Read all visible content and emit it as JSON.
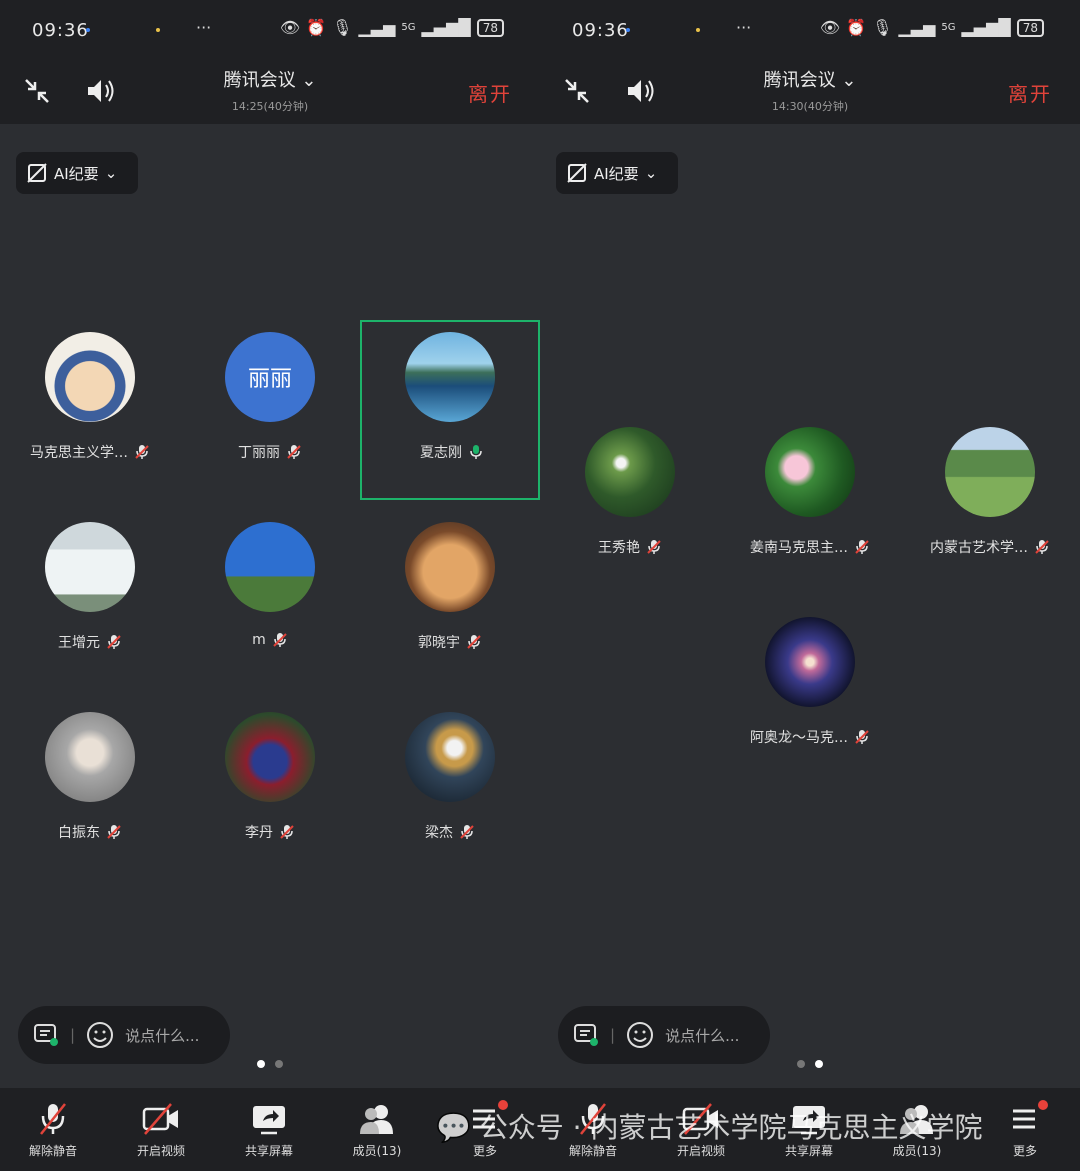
{
  "status": {
    "time": "09:36",
    "dots": "···",
    "network": "5G",
    "battery": "78"
  },
  "header": {
    "title": "腾讯会议",
    "leave": "离开"
  },
  "ai_button": {
    "label": "AI纪要"
  },
  "chat": {
    "placeholder": "说点什么..."
  },
  "toolbar": {
    "mic": "解除静音",
    "video": "开启视频",
    "share": "共享屏幕",
    "members": "成员(13)",
    "more": "更多"
  },
  "watermark": "公众号 · 内蒙古艺术学院马克思主义学院",
  "screens": [
    {
      "duration": "14:25(40分钟)",
      "participants": [
        {
          "name": "马克思主义学…",
          "avatar_text": "",
          "speaking": false
        },
        {
          "name": "丁丽丽",
          "avatar_text": "丽丽",
          "speaking": false
        },
        {
          "name": "夏志刚",
          "avatar_text": "",
          "speaking": true
        },
        {
          "name": "王增元",
          "avatar_text": "",
          "speaking": false
        },
        {
          "name": "m",
          "avatar_text": "",
          "speaking": false
        },
        {
          "name": "郭晓宇",
          "avatar_text": "",
          "speaking": false
        },
        {
          "name": "白振东",
          "avatar_text": "",
          "speaking": false
        },
        {
          "name": "李丹",
          "avatar_text": "",
          "speaking": false
        },
        {
          "name": "梁杰",
          "avatar_text": "",
          "speaking": false
        }
      ]
    },
    {
      "duration": "14:30(40分钟)",
      "participants": [
        {
          "name": "王秀艳",
          "avatar_text": "",
          "speaking": false
        },
        {
          "name": "姜南马克思主…",
          "avatar_text": "",
          "speaking": false
        },
        {
          "name": "内蒙古艺术学…",
          "avatar_text": "",
          "speaking": false
        },
        {
          "name": "阿奥龙～马克…",
          "avatar_text": "",
          "speaking": false
        }
      ]
    }
  ],
  "colors": {
    "accent_green": "#1db36a",
    "leave_red": "#e0433a",
    "badge_red": "#e8413a"
  }
}
